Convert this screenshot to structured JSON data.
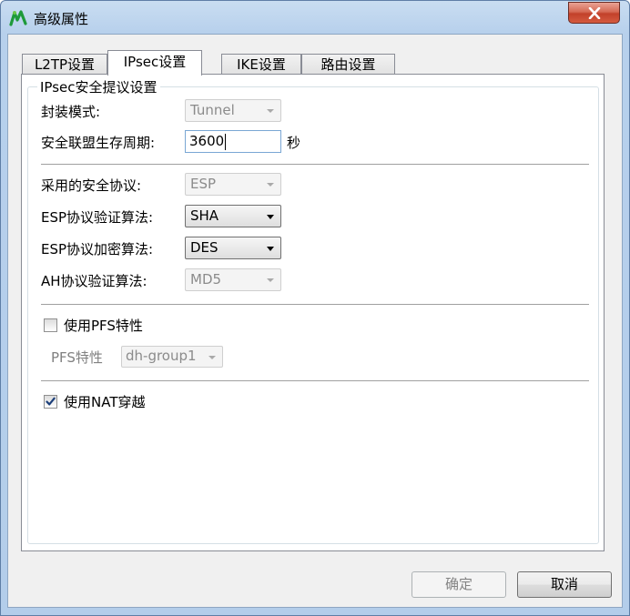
{
  "window": {
    "title": "高级属性"
  },
  "tabs": [
    {
      "label": "L2TP设置",
      "active": false
    },
    {
      "label": "IPsec设置",
      "active": true
    },
    {
      "label": "IKE设置",
      "active": false
    },
    {
      "label": "路由设置",
      "active": false
    }
  ],
  "group": {
    "title": "IPsec安全提议设置"
  },
  "fields": {
    "encapsulation": {
      "label": "封装模式:",
      "value": "Tunnel",
      "enabled": false
    },
    "lifetime": {
      "label": "安全联盟生存周期:",
      "value": "3600",
      "unit": "秒"
    },
    "protocol": {
      "label": "采用的安全协议:",
      "value": "ESP",
      "enabled": false
    },
    "esp_auth": {
      "label": "ESP协议验证算法:",
      "value": "SHA",
      "enabled": true
    },
    "esp_enc": {
      "label": "ESP协议加密算法:",
      "value": "DES",
      "enabled": true
    },
    "ah_auth": {
      "label": "AH协议验证算法:",
      "value": "MD5",
      "enabled": false
    }
  },
  "pfs": {
    "checkbox_label": "使用PFS特性",
    "checked": false,
    "select_label": "PFS特性",
    "select_value": "dh-group1"
  },
  "nat": {
    "checkbox_label": "使用NAT穿越",
    "checked": true
  },
  "buttons": {
    "ok": "确定",
    "cancel": "取消"
  },
  "colors": {
    "title_bar": "#b9d1ea",
    "close_button": "#c7432b",
    "check_mark": "#1c3f7a"
  }
}
